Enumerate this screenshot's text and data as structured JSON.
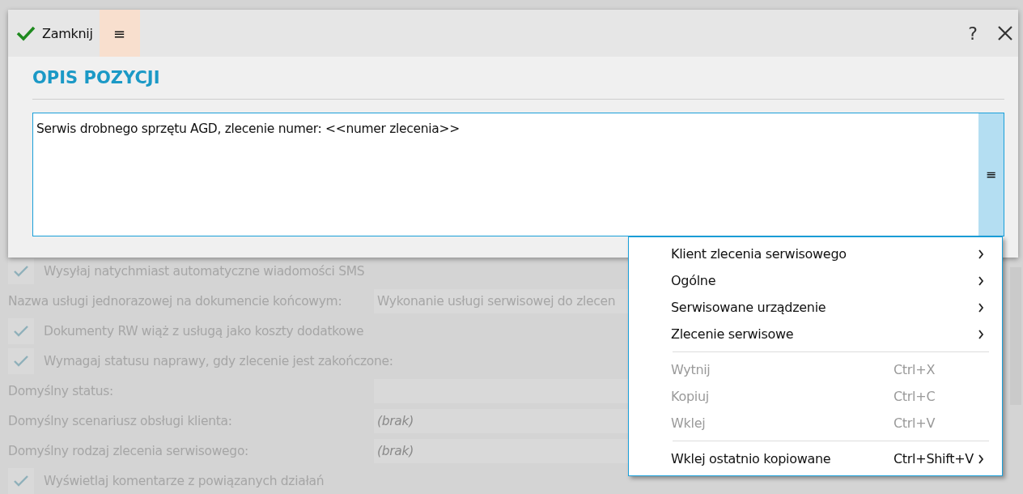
{
  "background_form": {
    "rows": [
      {
        "kind": "checkbox",
        "label": "Wysyłaj natychmiast automatyczne wiadomości SMS",
        "checked": true
      },
      {
        "kind": "field",
        "label": "Nazwa usługi jednorazowej na dokumencie końcowym:",
        "value": "Wykonanie usługi serwisowej do zlecen"
      },
      {
        "kind": "checkbox",
        "label": "Dokumenty RW wiąż z usługą jako koszty dodatkowe",
        "checked": true
      },
      {
        "kind": "checkbox",
        "label": "Wymagaj statusu naprawy, gdy zlecenie jest zakończone:",
        "checked": true
      },
      {
        "kind": "field",
        "label": "Domyślny status:"
      },
      {
        "kind": "field",
        "label": "Domyślny scenariusz obsługi klienta:",
        "placeholder": "(brak)"
      },
      {
        "kind": "field",
        "label": "Domyślny rodzaj zlecenia serwisowego:",
        "placeholder": "(brak)"
      },
      {
        "kind": "checkbox",
        "label": "Wyświetlaj komentarze z powiązanych działań",
        "checked": true
      }
    ]
  },
  "dialog": {
    "toolbar": {
      "close_button": {
        "label": "Zamknij"
      },
      "menu_button": {
        "label": "≡",
        "pressed": true
      },
      "help_button": {
        "label": "?"
      }
    },
    "title": "OPIS POZYCJI",
    "description": {
      "value": "Serwis drobnego sprzętu AGD, zlecenie numer: <<numer zlecenia>>",
      "menu_button": {
        "label": "≡"
      }
    }
  },
  "context_menu": {
    "items": [
      {
        "kind": "item",
        "label": "Klient zlecenia serwisowego",
        "submenu": true,
        "disabled": false
      },
      {
        "kind": "item",
        "label": "Ogólne",
        "submenu": true,
        "disabled": false
      },
      {
        "kind": "item",
        "label": "Serwisowane urządzenie",
        "submenu": true,
        "disabled": false
      },
      {
        "kind": "item",
        "label": "Zlecenie serwisowe",
        "submenu": true,
        "disabled": false
      },
      {
        "kind": "separator"
      },
      {
        "kind": "item",
        "label": "Wytnij",
        "shortcut": "Ctrl+X",
        "submenu": false,
        "disabled": true
      },
      {
        "kind": "item",
        "label": "Kopiuj",
        "shortcut": "Ctrl+C",
        "submenu": false,
        "disabled": true
      },
      {
        "kind": "item",
        "label": "Wklej",
        "shortcut": "Ctrl+V",
        "submenu": false,
        "disabled": true
      },
      {
        "kind": "separator"
      },
      {
        "kind": "item",
        "label": "Wklej ostatnio kopiowane",
        "shortcut": "Ctrl+Shift+V",
        "submenu": true,
        "disabled": false
      }
    ]
  }
}
